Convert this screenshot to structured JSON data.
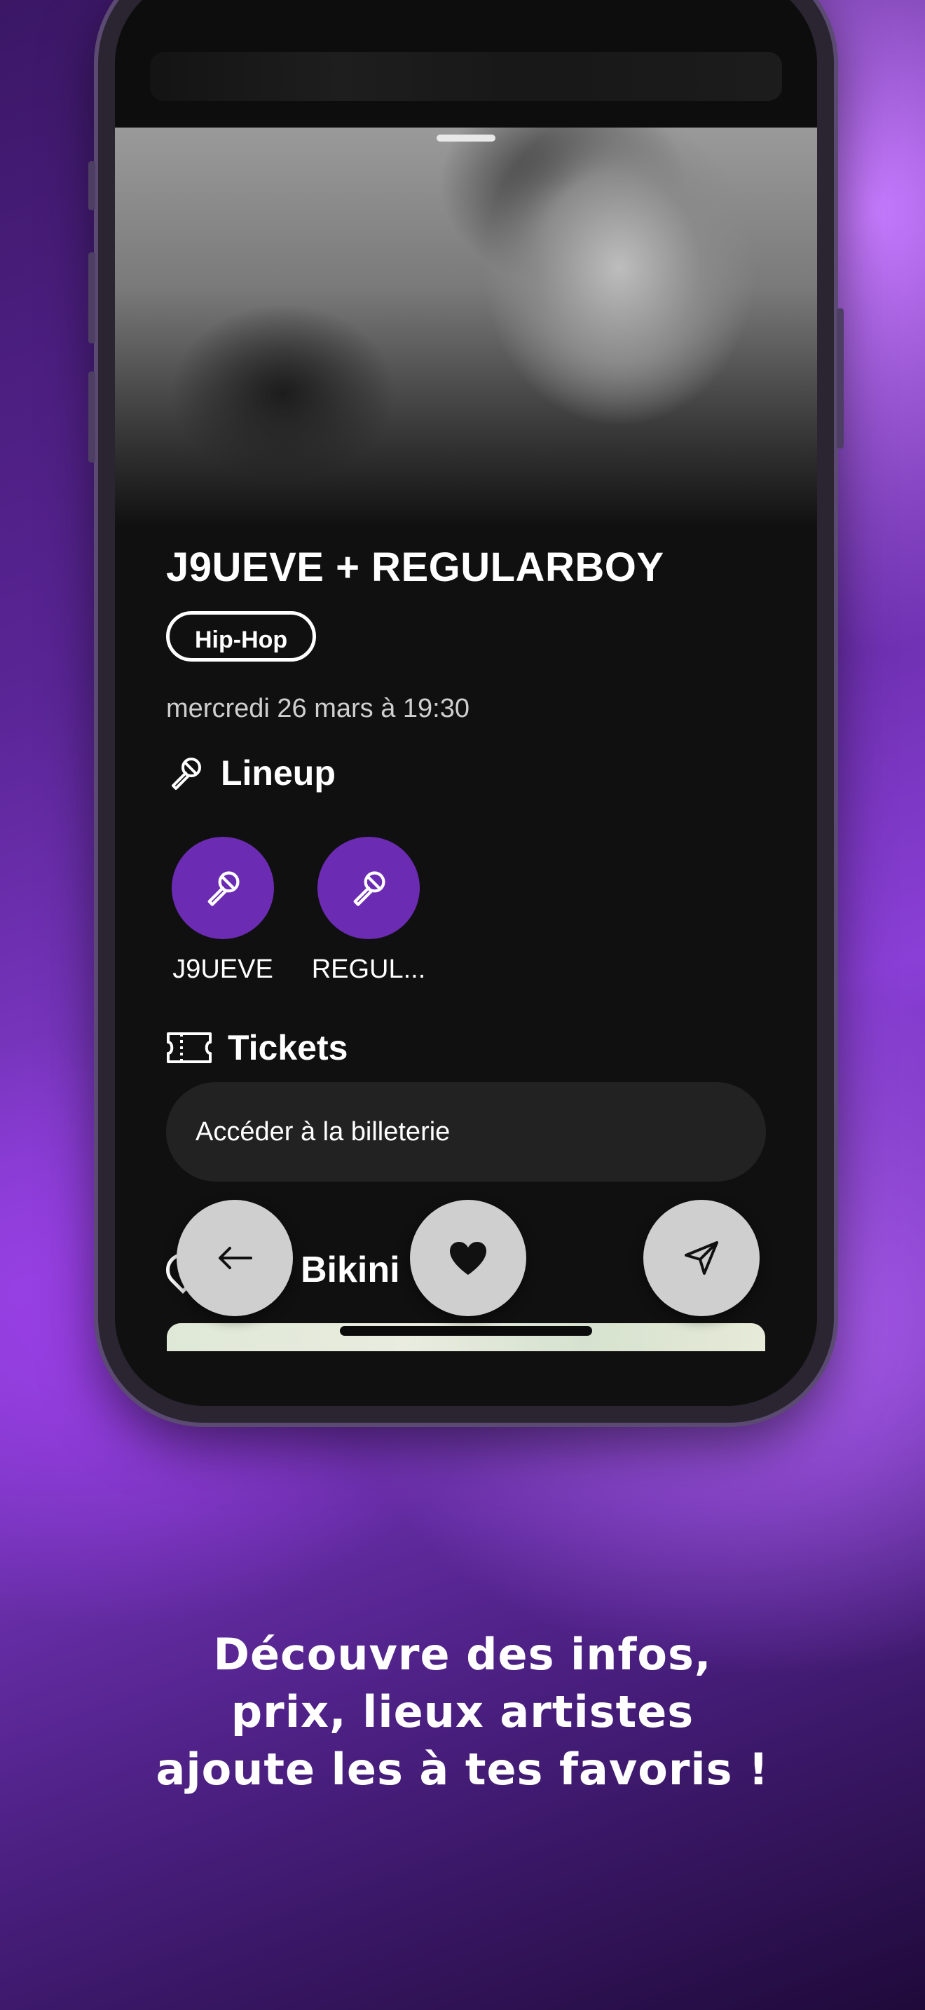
{
  "event": {
    "title": "J9UEVE + REGULARBOY",
    "genre": "Hip-Hop",
    "date": "mercredi 26 mars à 19:30"
  },
  "lineup": {
    "heading": "Lineup",
    "icon": "microphone-icon",
    "artists": [
      {
        "name": "J9UEVE"
      },
      {
        "name": "REGUL..."
      }
    ]
  },
  "tickets": {
    "heading": "Tickets",
    "icon": "ticket-icon",
    "button_label": "Accéder à la billeterie"
  },
  "venue": {
    "name_visible": "Bikini",
    "icon": "location-pin-icon"
  },
  "actions": {
    "back_icon": "arrow-left-icon",
    "favorite_icon": "heart-icon",
    "share_icon": "send-icon"
  },
  "caption": {
    "line1": "Découvre des infos,",
    "line2": "prix, lieux artistes",
    "line3": "ajoute les à tes favoris !"
  },
  "colors": {
    "accent": "#6b2bb3",
    "screen_bg": "#101010",
    "button_bg": "#222222",
    "fab_bg": "#cfcfcf"
  }
}
